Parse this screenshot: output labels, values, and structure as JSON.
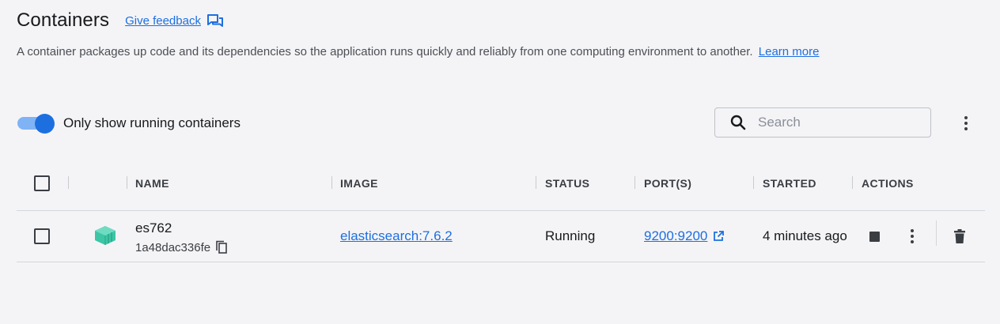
{
  "header": {
    "title": "Containers",
    "feedback_label": "Give feedback",
    "description": "A container packages up code and its dependencies so the application runs quickly and reliably from one computing environment to another.",
    "learn_more": "Learn more"
  },
  "toolbar": {
    "toggle_label": "Only show running containers",
    "toggle_on": true,
    "search_placeholder": "Search"
  },
  "table": {
    "columns": {
      "name": "NAME",
      "image": "IMAGE",
      "status": "STATUS",
      "ports": "PORT(S)",
      "started": "STARTED",
      "actions": "ACTIONS"
    },
    "rows": [
      {
        "name": "es762",
        "id": "1a48dac336fe",
        "image": "elasticsearch:7.6.2",
        "status": "Running",
        "ports": "9200:9200",
        "started": "4 minutes ago"
      }
    ]
  },
  "colors": {
    "accent": "#1d6fe0",
    "container_icon": "#3cc6a6",
    "background": "#f4f4f6"
  },
  "icons": {
    "feedback": "feedback-icon",
    "search": "search-icon",
    "more": "more-vert-icon",
    "container": "container-icon",
    "copy": "copy-icon",
    "external_link": "external-link-icon",
    "stop": "stop-icon",
    "delete": "trash-icon"
  }
}
